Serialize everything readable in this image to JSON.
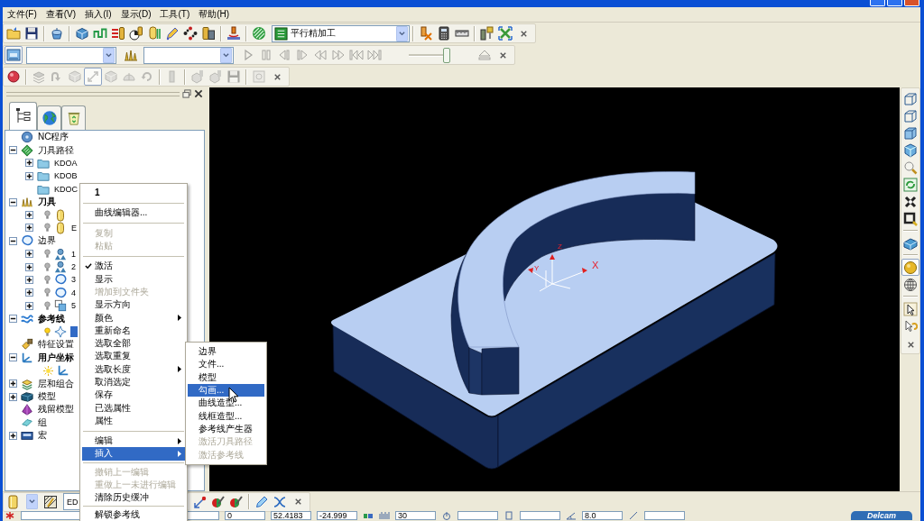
{
  "menu_bar": [
    "文件(F)",
    "查看(V)",
    "插入(I)",
    "显示(D)",
    "工具(T)",
    "帮助(H)"
  ],
  "toolbars": [
    {
      "groups": [
        [
          {
            "kind": "folder",
            "disabled": false,
            "pressed": false
          },
          {
            "kind": "floppy",
            "disabled": false,
            "pressed": false
          }
        ],
        [
          {
            "kind": "pot",
            "disabled": false,
            "pressed": false
          }
        ],
        [
          {
            "kind": "box",
            "disabled": false,
            "pressed": false
          },
          {
            "kind": "steps",
            "disabled": false,
            "pressed": false
          },
          {
            "kind": "lines",
            "disabled": false,
            "pressed": false
          },
          {
            "kind": "ball",
            "disabled": false,
            "pressed": false
          },
          {
            "kind": "cylinder",
            "disabled": false,
            "pressed": false
          },
          {
            "kind": "pencil",
            "disabled": false,
            "pressed": false
          },
          {
            "kind": "diamond",
            "disabled": false,
            "pressed": false
          },
          {
            "kind": "stack",
            "disabled": false,
            "pressed": false
          }
        ],
        [
          {
            "kind": "mill",
            "disabled": false,
            "pressed": false
          }
        ],
        [
          {
            "kind": "stripes",
            "disabled": false,
            "pressed": false
          },
          {
            "kind": "listcombo",
            "disabled": false,
            "pressed": false,
            "value": "平行精加工"
          }
        ],
        [
          {
            "kind": "xray",
            "disabled": false,
            "pressed": false
          },
          {
            "kind": "calculator",
            "disabled": false,
            "pressed": false
          },
          {
            "kind": "ruler",
            "disabled": false,
            "pressed": false
          }
        ],
        [
          {
            "kind": "tools",
            "disabled": false,
            "pressed": false
          },
          {
            "kind": "arrows",
            "disabled": false,
            "pressed": false
          }
        ]
      ]
    },
    {
      "groups": [
        [
          {
            "kind": "screen",
            "disabled": false,
            "pressed": true
          },
          {
            "kind": "combo",
            "disabled": false,
            "pressed": false
          },
          {
            "kind": "ytools",
            "disabled": false,
            "pressed": false
          },
          {
            "kind": "combo",
            "disabled": false,
            "pressed": false
          },
          {
            "kind": "play",
            "disabled": true,
            "pressed": false
          },
          {
            "kind": "pause",
            "disabled": true,
            "pressed": false
          },
          {
            "kind": "stepback",
            "disabled": true,
            "pressed": false
          },
          {
            "kind": "stepfwd",
            "disabled": true,
            "pressed": false
          },
          {
            "kind": "rewind",
            "disabled": true,
            "pressed": false
          },
          {
            "kind": "ffwd",
            "disabled": true,
            "pressed": false
          },
          {
            "kind": "tostart",
            "disabled": true,
            "pressed": false
          },
          {
            "kind": "toend",
            "disabled": true,
            "pressed": false
          },
          {
            "kind": "slider",
            "disabled": false,
            "pressed": false,
            "level": 1
          },
          {
            "kind": "eject",
            "disabled": true,
            "pressed": false
          }
        ]
      ]
    },
    {
      "groups": [
        [
          {
            "kind": "record",
            "disabled": false,
            "pressed": false
          }
        ],
        [
          {
            "kind": "layers",
            "disabled": true,
            "pressed": false
          },
          {
            "kind": "turn",
            "disabled": true,
            "pressed": false
          },
          {
            "kind": "cube",
            "disabled": true,
            "pressed": false
          },
          {
            "kind": "diagonal",
            "disabled": true,
            "pressed": true
          },
          {
            "kind": "cube",
            "disabled": true,
            "pressed": false
          },
          {
            "kind": "halfdisc",
            "disabled": true,
            "pressed": false
          },
          {
            "kind": "rotate",
            "disabled": true,
            "pressed": false
          }
        ],
        [
          {
            "kind": "bar",
            "disabled": true,
            "pressed": false
          }
        ],
        [
          {
            "kind": "cubetool",
            "disabled": true,
            "pressed": false
          },
          {
            "kind": "cubetool",
            "disabled": true,
            "pressed": false
          },
          {
            "kind": "floppy",
            "disabled": true,
            "pressed": false
          }
        ],
        [
          {
            "kind": "square",
            "disabled": true,
            "pressed": false
          }
        ]
      ]
    }
  ],
  "explorer": {
    "tabs": [
      {
        "kind": "tree",
        "selected": true
      },
      {
        "kind": "globe",
        "selected": false
      },
      {
        "kind": "bin",
        "selected": false
      }
    ],
    "tree": [
      {
        "kind": "program",
        "label": "NC程序",
        "expandable": false,
        "bold": false,
        "selected": false
      },
      {
        "kind": "toolpaths",
        "label": "刀具路径",
        "expandable": true,
        "expanded": true,
        "bold": false,
        "selected": false,
        "children": [
          {
            "kind": "folder",
            "label": "KDOA",
            "expandable": true,
            "expanded": false,
            "bold": false,
            "selected": false
          },
          {
            "kind": "folder",
            "label": "KDOB",
            "expandable": true,
            "expanded": false,
            "bold": false,
            "selected": false
          },
          {
            "kind": "folder",
            "label": "KDOC",
            "expandable": false,
            "bold": false,
            "selected": false
          }
        ]
      },
      {
        "kind": "tools",
        "label": "刀具",
        "expandable": true,
        "expanded": true,
        "bold": true,
        "selected": false,
        "children": [
          {
            "kind": "tool",
            "expandable": true,
            "expanded": false,
            "selected": false,
            "marker": {
              "kind": "bulb",
              "on": false
            }
          },
          {
            "kind": "tool",
            "label": "E",
            "expandable": true,
            "expanded": false,
            "bold": false,
            "selected": false,
            "marker": {
              "kind": "bulb",
              "on": false
            }
          }
        ]
      },
      {
        "kind": "boundaries",
        "label": "边界",
        "expandable": true,
        "expanded": true,
        "bold": false,
        "selected": false,
        "children": [
          {
            "kind": "cluster",
            "label": "1",
            "expandable": true,
            "expanded": false,
            "bold": false,
            "selected": false,
            "marker": {
              "kind": "bulb",
              "on": false
            }
          },
          {
            "kind": "cluster",
            "label": "2",
            "expandable": true,
            "expanded": false,
            "bold": false,
            "selected": false,
            "marker": {
              "kind": "bulb",
              "on": false
            }
          },
          {
            "kind": "outline",
            "label": "3",
            "expandable": true,
            "expanded": false,
            "bold": false,
            "selected": false,
            "marker": {
              "kind": "bulb",
              "on": false
            }
          },
          {
            "kind": "outline",
            "label": "4",
            "expandable": true,
            "expanded": false,
            "bold": false,
            "selected": false,
            "marker": {
              "kind": "bulb",
              "on": false
            }
          },
          {
            "kind": "squares",
            "label": "5",
            "expandable": true,
            "expanded": false,
            "bold": false,
            "selected": false,
            "marker": {
              "kind": "bulb",
              "on": false
            }
          }
        ]
      },
      {
        "kind": "patterns",
        "label": "参考线",
        "expandable": true,
        "expanded": true,
        "bold": true,
        "selected": false,
        "children": [
          {
            "kind": "pattern",
            "expandable": false,
            "selected": true,
            "marker": {
              "kind": "bulb",
              "on": true
            }
          }
        ]
      },
      {
        "kind": "features",
        "label": "特征设置",
        "expandable": false,
        "bold": false,
        "selected": false
      },
      {
        "kind": "workplanes",
        "label": "用户坐标",
        "expandable": true,
        "expanded": true,
        "bold": true,
        "selected": false,
        "children": [
          {
            "kind": "workplane",
            "expandable": false,
            "selected": false,
            "marker": {
              "kind": "sun",
              "on": true
            }
          }
        ]
      },
      {
        "kind": "levels",
        "label": "层和组合",
        "expandable": true,
        "expanded": false,
        "bold": false,
        "selected": false
      },
      {
        "kind": "models",
        "label": "模型",
        "expandable": true,
        "expanded": false,
        "bold": false,
        "selected": false
      },
      {
        "kind": "stock",
        "label": "残留模型",
        "expandable": false,
        "bold": false,
        "selected": false
      },
      {
        "kind": "groups",
        "label": "组",
        "expandable": false,
        "bold": false,
        "selected": false
      },
      {
        "kind": "macros",
        "label": "宏",
        "expandable": true,
        "expanded": false,
        "bold": false,
        "selected": false
      }
    ]
  },
  "viewport": {
    "axis_labels": [
      "X",
      "Y",
      "Z"
    ]
  },
  "view_toolbar": {
    "groups": [
      [
        {
          "kind": "wirecube",
          "disabled": false,
          "pressed": false
        },
        {
          "kind": "wirecube",
          "disabled": false,
          "pressed": false
        },
        {
          "kind": "solidcube",
          "disabled": false,
          "pressed": false
        },
        {
          "kind": "isocube",
          "disabled": false,
          "pressed": false
        },
        {
          "kind": "zoom",
          "disabled": false,
          "pressed": false
        },
        {
          "kind": "refresh",
          "disabled": false,
          "pressed": false
        },
        {
          "kind": "fit",
          "disabled": false,
          "pressed": false
        },
        {
          "kind": "zoombox",
          "disabled": false,
          "pressed": false
        }
      ],
      [
        {
          "kind": "block",
          "disabled": false,
          "pressed": false
        }
      ],
      [
        {
          "kind": "sphere",
          "disabled": false,
          "pressed": true
        },
        {
          "kind": "globe",
          "disabled": false,
          "pressed": false
        }
      ],
      [
        {
          "kind": "pointer",
          "disabled": false,
          "pressed": false
        },
        {
          "kind": "lasso",
          "disabled": false,
          "pressed": false
        }
      ]
    ]
  },
  "bottom_toolbar": {
    "groups": [
      [
        {
          "kind": "ytool",
          "disabled": false,
          "pressed": false
        },
        {
          "kind": "dropdown",
          "disabled": false,
          "pressed": false
        },
        {
          "kind": "hatch",
          "disabled": false,
          "pressed": false
        },
        {
          "kind": "combo",
          "disabled": false,
          "pressed": false,
          "value": "ED"
        }
      ],
      [
        {
          "kind": "penline",
          "disabled": false,
          "pressed": false
        },
        {
          "kind": "pens",
          "disabled": false,
          "pressed": false
        },
        {
          "kind": "pens",
          "disabled": false,
          "pressed": false
        }
      ],
      [
        {
          "kind": "bluepencil",
          "disabled": false,
          "pressed": false
        },
        {
          "kind": "curvex",
          "disabled": false,
          "pressed": false
        }
      ]
    ]
  },
  "status_bar": {
    "items": [
      {
        "kind": "asterisk"
      },
      {
        "kind": "field"
      },
      {
        "kind": "field",
        "value": "0"
      },
      {
        "kind": "field",
        "value": "52.4183"
      },
      {
        "kind": "field",
        "value": "-24.999"
      },
      {
        "kind": "cubes"
      },
      {
        "kind": "bars"
      },
      {
        "kind": "field",
        "value": "30"
      },
      {
        "kind": "power"
      },
      {
        "kind": "field"
      },
      {
        "kind": "rect"
      },
      {
        "kind": "field"
      },
      {
        "kind": "angle"
      },
      {
        "kind": "field",
        "value": "8.0"
      },
      {
        "kind": "slash"
      },
      {
        "kind": "field"
      },
      {
        "kind": "logo",
        "value": "Delcam"
      }
    ]
  },
  "context_menu": {
    "items": [
      {
        "kind": "header",
        "label": "1"
      },
      {
        "kind": "separator"
      },
      {
        "kind": "item",
        "label": "曲线编辑器...",
        "checked": false,
        "disabled": false,
        "selected": false,
        "submenu": false
      },
      {
        "kind": "separator"
      },
      {
        "kind": "item",
        "label": "复制",
        "checked": false,
        "disabled": true,
        "selected": false,
        "submenu": false
      },
      {
        "kind": "item",
        "label": "粘贴",
        "checked": false,
        "disabled": true,
        "selected": false,
        "submenu": false
      },
      {
        "kind": "separator"
      },
      {
        "kind": "item",
        "label": "激活",
        "checked": true,
        "disabled": false,
        "selected": false,
        "submenu": false
      },
      {
        "kind": "item",
        "label": "显示",
        "checked": false,
        "disabled": false,
        "selected": false,
        "submenu": false
      },
      {
        "kind": "item",
        "label": "增加到文件夹",
        "checked": false,
        "disabled": true,
        "selected": false,
        "submenu": false
      },
      {
        "kind": "item",
        "label": "显示方向",
        "checked": false,
        "disabled": false,
        "selected": false,
        "submenu": false
      },
      {
        "kind": "item",
        "label": "颜色",
        "checked": false,
        "disabled": false,
        "selected": false,
        "submenu": true
      },
      {
        "kind": "item",
        "label": "重新命名",
        "checked": false,
        "disabled": false,
        "selected": false,
        "submenu": false
      },
      {
        "kind": "item",
        "label": "选取全部",
        "checked": false,
        "disabled": false,
        "selected": false,
        "submenu": false
      },
      {
        "kind": "item",
        "label": "选取重复",
        "checked": false,
        "disabled": false,
        "selected": false,
        "submenu": false
      },
      {
        "kind": "item",
        "label": "选取长度",
        "checked": false,
        "disabled": false,
        "selected": false,
        "submenu": true
      },
      {
        "kind": "item",
        "label": "取消选定",
        "checked": false,
        "disabled": false,
        "selected": false,
        "submenu": false
      },
      {
        "kind": "item",
        "label": "保存",
        "checked": false,
        "disabled": false,
        "selected": false,
        "submenu": false
      },
      {
        "kind": "item",
        "label": "已选属性",
        "checked": false,
        "disabled": false,
        "selected": false,
        "submenu": false
      },
      {
        "kind": "item",
        "label": "属性",
        "checked": false,
        "disabled": false,
        "selected": false,
        "submenu": false
      },
      {
        "kind": "separator"
      },
      {
        "kind": "item",
        "label": "编辑",
        "checked": false,
        "disabled": false,
        "selected": false,
        "submenu": true
      },
      {
        "kind": "item",
        "label": "插入",
        "checked": false,
        "disabled": false,
        "selected": true,
        "submenu": true
      },
      {
        "kind": "separator"
      },
      {
        "kind": "item",
        "label": "撤销上一编辑",
        "checked": false,
        "disabled": true,
        "selected": false,
        "submenu": false
      },
      {
        "kind": "item",
        "label": "重做上一未进行编辑",
        "checked": false,
        "disabled": true,
        "selected": false,
        "submenu": false
      },
      {
        "kind": "item",
        "label": "清除历史缓冲",
        "checked": false,
        "disabled": false,
        "selected": false,
        "submenu": false
      },
      {
        "kind": "separator"
      },
      {
        "kind": "item",
        "label": "解锁参考线",
        "checked": false,
        "disabled": false,
        "selected": false,
        "submenu": false
      }
    ]
  },
  "submenu": {
    "items": [
      {
        "kind": "item",
        "label": "边界",
        "disabled": false,
        "selected": false
      },
      {
        "kind": "item",
        "label": "文件...",
        "disabled": false,
        "selected": false
      },
      {
        "kind": "item",
        "label": "模型",
        "disabled": false,
        "selected": false
      },
      {
        "kind": "item",
        "label": "勾画...",
        "disabled": false,
        "selected": true
      },
      {
        "kind": "item",
        "label": "曲线造型...",
        "disabled": false,
        "selected": false
      },
      {
        "kind": "item",
        "label": "线框造型...",
        "disabled": false,
        "selected": false
      },
      {
        "kind": "item",
        "label": "参考线产生器",
        "disabled": false,
        "selected": false
      },
      {
        "kind": "item",
        "label": "激活刀具路径",
        "disabled": true,
        "selected": false
      },
      {
        "kind": "item",
        "label": "激活参考线",
        "disabled": true,
        "selected": false
      }
    ]
  }
}
